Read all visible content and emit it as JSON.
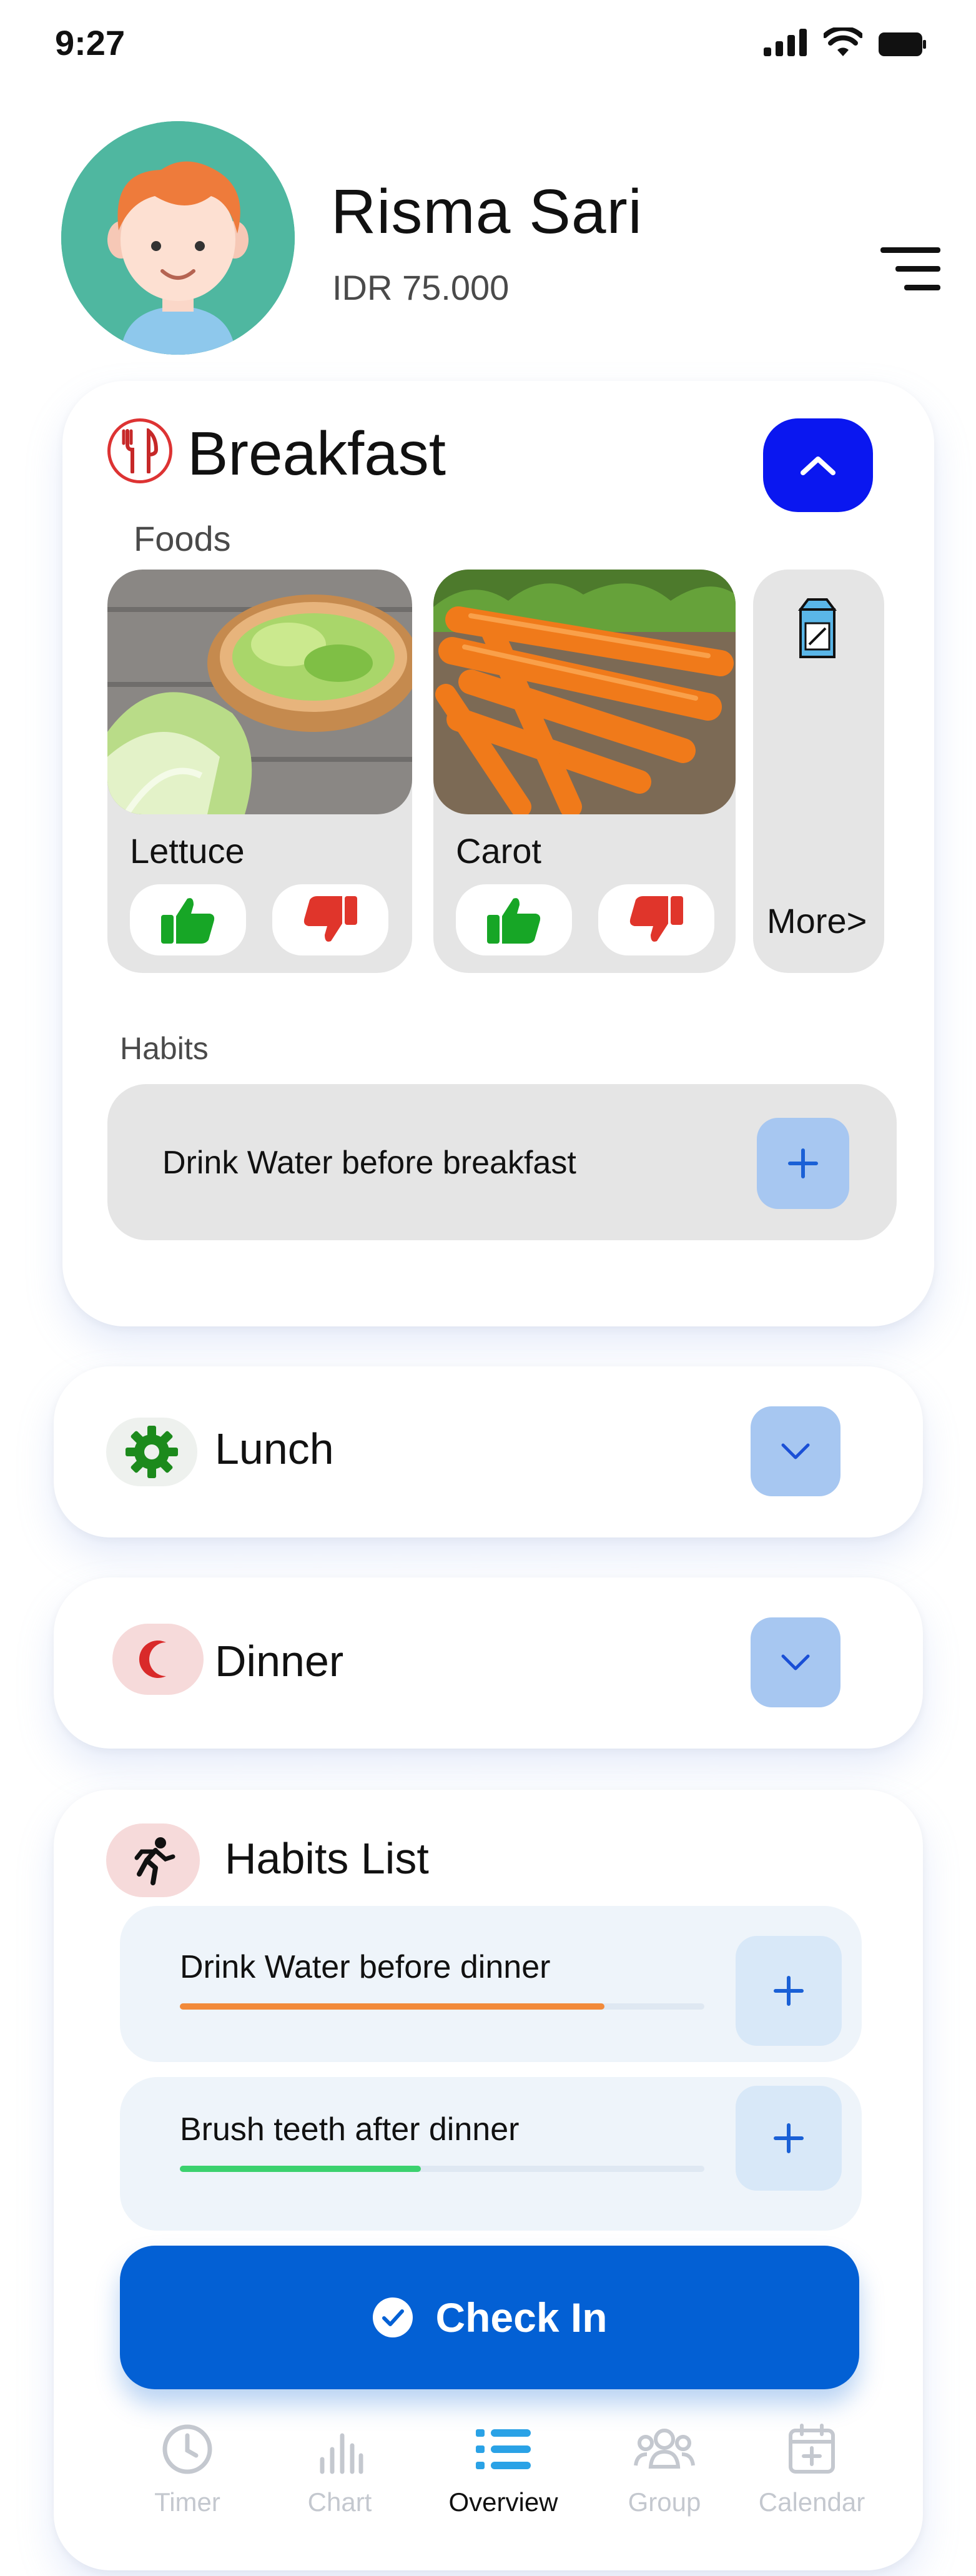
{
  "status_bar": {
    "time": "9:27"
  },
  "header": {
    "name": "Risma Sari",
    "balance": "IDR 75.000"
  },
  "breakfast": {
    "title": "Breakfast",
    "foods_label": "Foods",
    "foods": [
      {
        "name": "Lettuce"
      },
      {
        "name": "Carot"
      }
    ],
    "more_label": "More>",
    "habits_label": "Habits",
    "habit": "Drink Water before breakfast"
  },
  "lunch": {
    "title": "Lunch"
  },
  "dinner": {
    "title": "Dinner"
  },
  "habits_list": {
    "title": "Habits List",
    "items": [
      {
        "label": "Drink Water before dinner",
        "progress": 0.81,
        "color": "#f28a3a"
      },
      {
        "label": "Brush teeth after dinner",
        "progress": 0.46,
        "color": "#3bd16e"
      }
    ]
  },
  "check_in": {
    "label": "Check In"
  },
  "nav": {
    "items": [
      {
        "label": "Timer",
        "icon": "clock-icon"
      },
      {
        "label": "Chart",
        "icon": "bar-chart-icon"
      },
      {
        "label": "Overview",
        "icon": "list-icon",
        "active": true
      },
      {
        "label": "Group",
        "icon": "group-icon"
      },
      {
        "label": "Calendar",
        "icon": "calendar-icon"
      }
    ]
  },
  "colors": {
    "primary": "#0a17f0",
    "check_in": "#0360d4",
    "soft_button": "#a7c7f1",
    "thumb_up": "#17a626",
    "thumb_down": "#e0352b"
  }
}
